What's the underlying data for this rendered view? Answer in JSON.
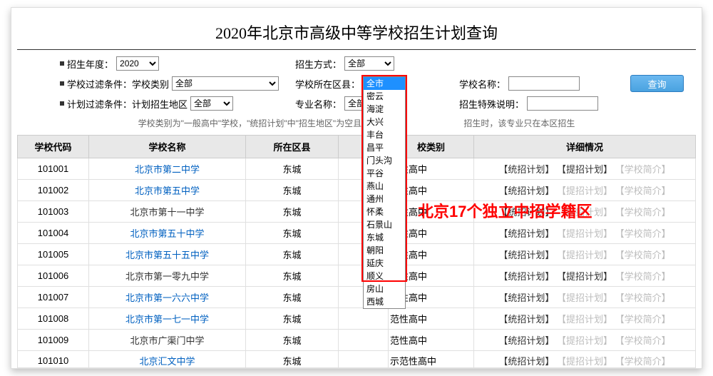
{
  "title": "2020年北京市高级中等学校招生计划查询",
  "filters": {
    "year_label": "招生年度：",
    "year_value": "2020",
    "mode_label": "招生方式：",
    "mode_value": "全部",
    "school_filter_label": "学校过滤条件：",
    "school_type_label": "学校类别",
    "school_type_value": "全部",
    "district_label": "学校所在区县：",
    "district_value": "全市",
    "school_name_label": "学校名称：",
    "school_name_value": "",
    "plan_filter_label": "计划过滤条件：",
    "plan_area_label": "计划招生地区",
    "plan_area_value": "全部",
    "major_label": "专业名称：",
    "major_value": "全部",
    "special_label": "招生特殊说明：",
    "special_value": "",
    "query_btn": "查询"
  },
  "district_options": [
    "全市",
    "密云",
    "海淀",
    "大兴",
    "丰台",
    "昌平",
    "门头沟",
    "平谷",
    "燕山",
    "通州",
    "怀柔",
    "石景山",
    "东城",
    "朝阳",
    "延庆",
    "顺义",
    "房山",
    "西城"
  ],
  "hint_part1": "学校类别为\"一般高中\"学校，\"统招计划\"中\"招生地区\"为空且\"招生人数\"",
  "hint_part2": "招生时，该专业只在本区招生",
  "columns": [
    "学校代码",
    "学校名称",
    "所在区县",
    "",
    "校类别",
    "详细情况"
  ],
  "rows": [
    {
      "code": "101001",
      "name": "北京市第二中学",
      "link": true,
      "district": "东城",
      "type": "范性高中",
      "d1": "【统招计划】",
      "d1a": true,
      "d2": "【提招计划】",
      "d2a": true,
      "d3": "【学校简介】",
      "d3a": false
    },
    {
      "code": "101002",
      "name": "北京市第五中学",
      "link": true,
      "district": "东城",
      "type": "范性高中",
      "d1": "【统招计划】",
      "d1a": true,
      "d2": "【提招计划】",
      "d2a": false,
      "d3": "【学校简介】",
      "d3a": false
    },
    {
      "code": "101003",
      "name": "北京市第十一中学",
      "link": false,
      "district": "东城",
      "type": "范性高中",
      "d1": "【统招计划】",
      "d1a": true,
      "d2": "【提招计划】",
      "d2a": false,
      "d3": "【学校简介】",
      "d3a": false
    },
    {
      "code": "101004",
      "name": "北京市第五十中学",
      "link": true,
      "district": "东城",
      "type": "范性高中",
      "d1": "【统招计划】",
      "d1a": true,
      "d2": "【提招计划】",
      "d2a": false,
      "d3": "【学校简介】",
      "d3a": false
    },
    {
      "code": "101005",
      "name": "北京市第五十五中学",
      "link": true,
      "district": "东城",
      "type": "范性高中",
      "d1": "【统招计划】",
      "d1a": true,
      "d2": "【提招计划】",
      "d2a": false,
      "d3": "【学校简介】",
      "d3a": false
    },
    {
      "code": "101006",
      "name": "北京市第一零九中学",
      "link": false,
      "district": "东城",
      "type": "范性高中",
      "d1": "【统招计划】",
      "d1a": true,
      "d2": "【提招计划】",
      "d2a": true,
      "d3": "【学校简介】",
      "d3a": false
    },
    {
      "code": "101007",
      "name": "北京市第一六六中学",
      "link": true,
      "district": "东城",
      "type": "范性高中",
      "d1": "【统招计划】",
      "d1a": true,
      "d2": "【提招计划】",
      "d2a": false,
      "d3": "【学校简介】",
      "d3a": false
    },
    {
      "code": "101008",
      "name": "北京市第一七一中学",
      "link": true,
      "district": "东城",
      "type": "范性高中",
      "d1": "【统招计划】",
      "d1a": true,
      "d2": "【提招计划】",
      "d2a": false,
      "d3": "【学校简介】",
      "d3a": false
    },
    {
      "code": "101009",
      "name": "北京市广渠门中学",
      "link": false,
      "district": "东城",
      "type": "范性高中",
      "d1": "【统招计划】",
      "d1a": true,
      "d2": "【提招计划】",
      "d2a": false,
      "d3": "【学校简介】",
      "d3a": false
    },
    {
      "code": "101010",
      "name": "北京汇文中学",
      "link": true,
      "district": "东城",
      "type": "示范性高中",
      "d1": "【统招计划】",
      "d1a": true,
      "d2": "【提招计划】",
      "d2a": false,
      "d3": "【学校简介】",
      "d3a": false
    }
  ],
  "annotation": "北京17个独立中招学籍区"
}
